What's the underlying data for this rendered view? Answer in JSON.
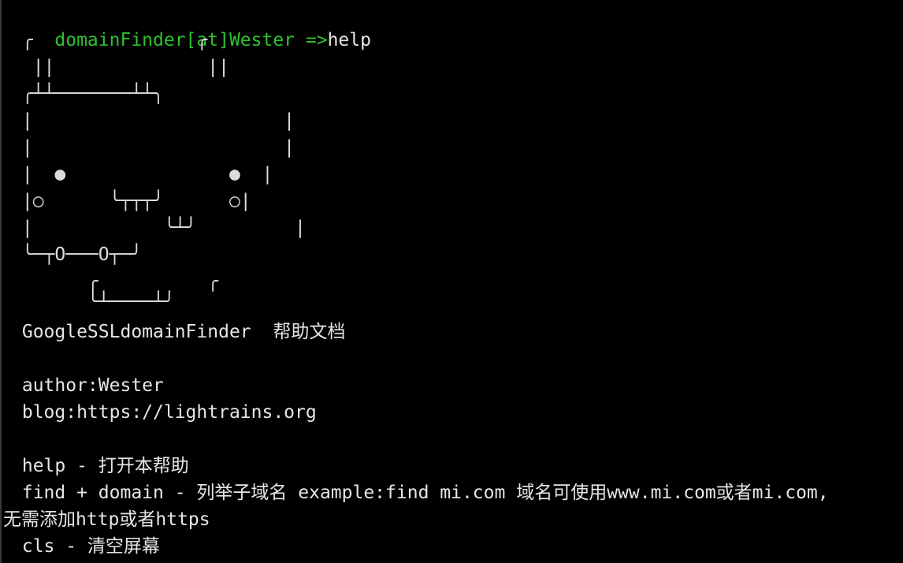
{
  "colors": {
    "background": "#000000",
    "prompt": "#2ec22e",
    "text": "#e6e6e6"
  },
  "prompt": {
    "user_host": "domainFinder[at]Wester =>",
    "command": "help"
  },
  "ascii_art": [
    " ╭               ╭",
    "  ||              ||",
    " ╭┴┴───────┴┴╮",
    " |                       |",
    " |                       |",
    " |  ●               ●  |",
    " |○      ╰┬┬┬╯      ○|",
    " |            ╰┴╯         |",
    " ╰─┬O───O┬─╯",
    "       ╭          ╭",
    "       ╰┴────┴╯"
  ],
  "help": {
    "title": " GoogleSSLdomainFinder  帮助文档",
    "author": " author:Wester",
    "blog": " blog:https://lightrains.org",
    "cmd_help": " help - 打开本帮助",
    "cmd_find": " find + domain - 列举子域名 example:find mi.com 域名可使用www.mi.com或者mi.com,",
    "cmd_find_cont": "无需添加http或者https",
    "cmd_cls": " cls - 清空屏幕"
  }
}
